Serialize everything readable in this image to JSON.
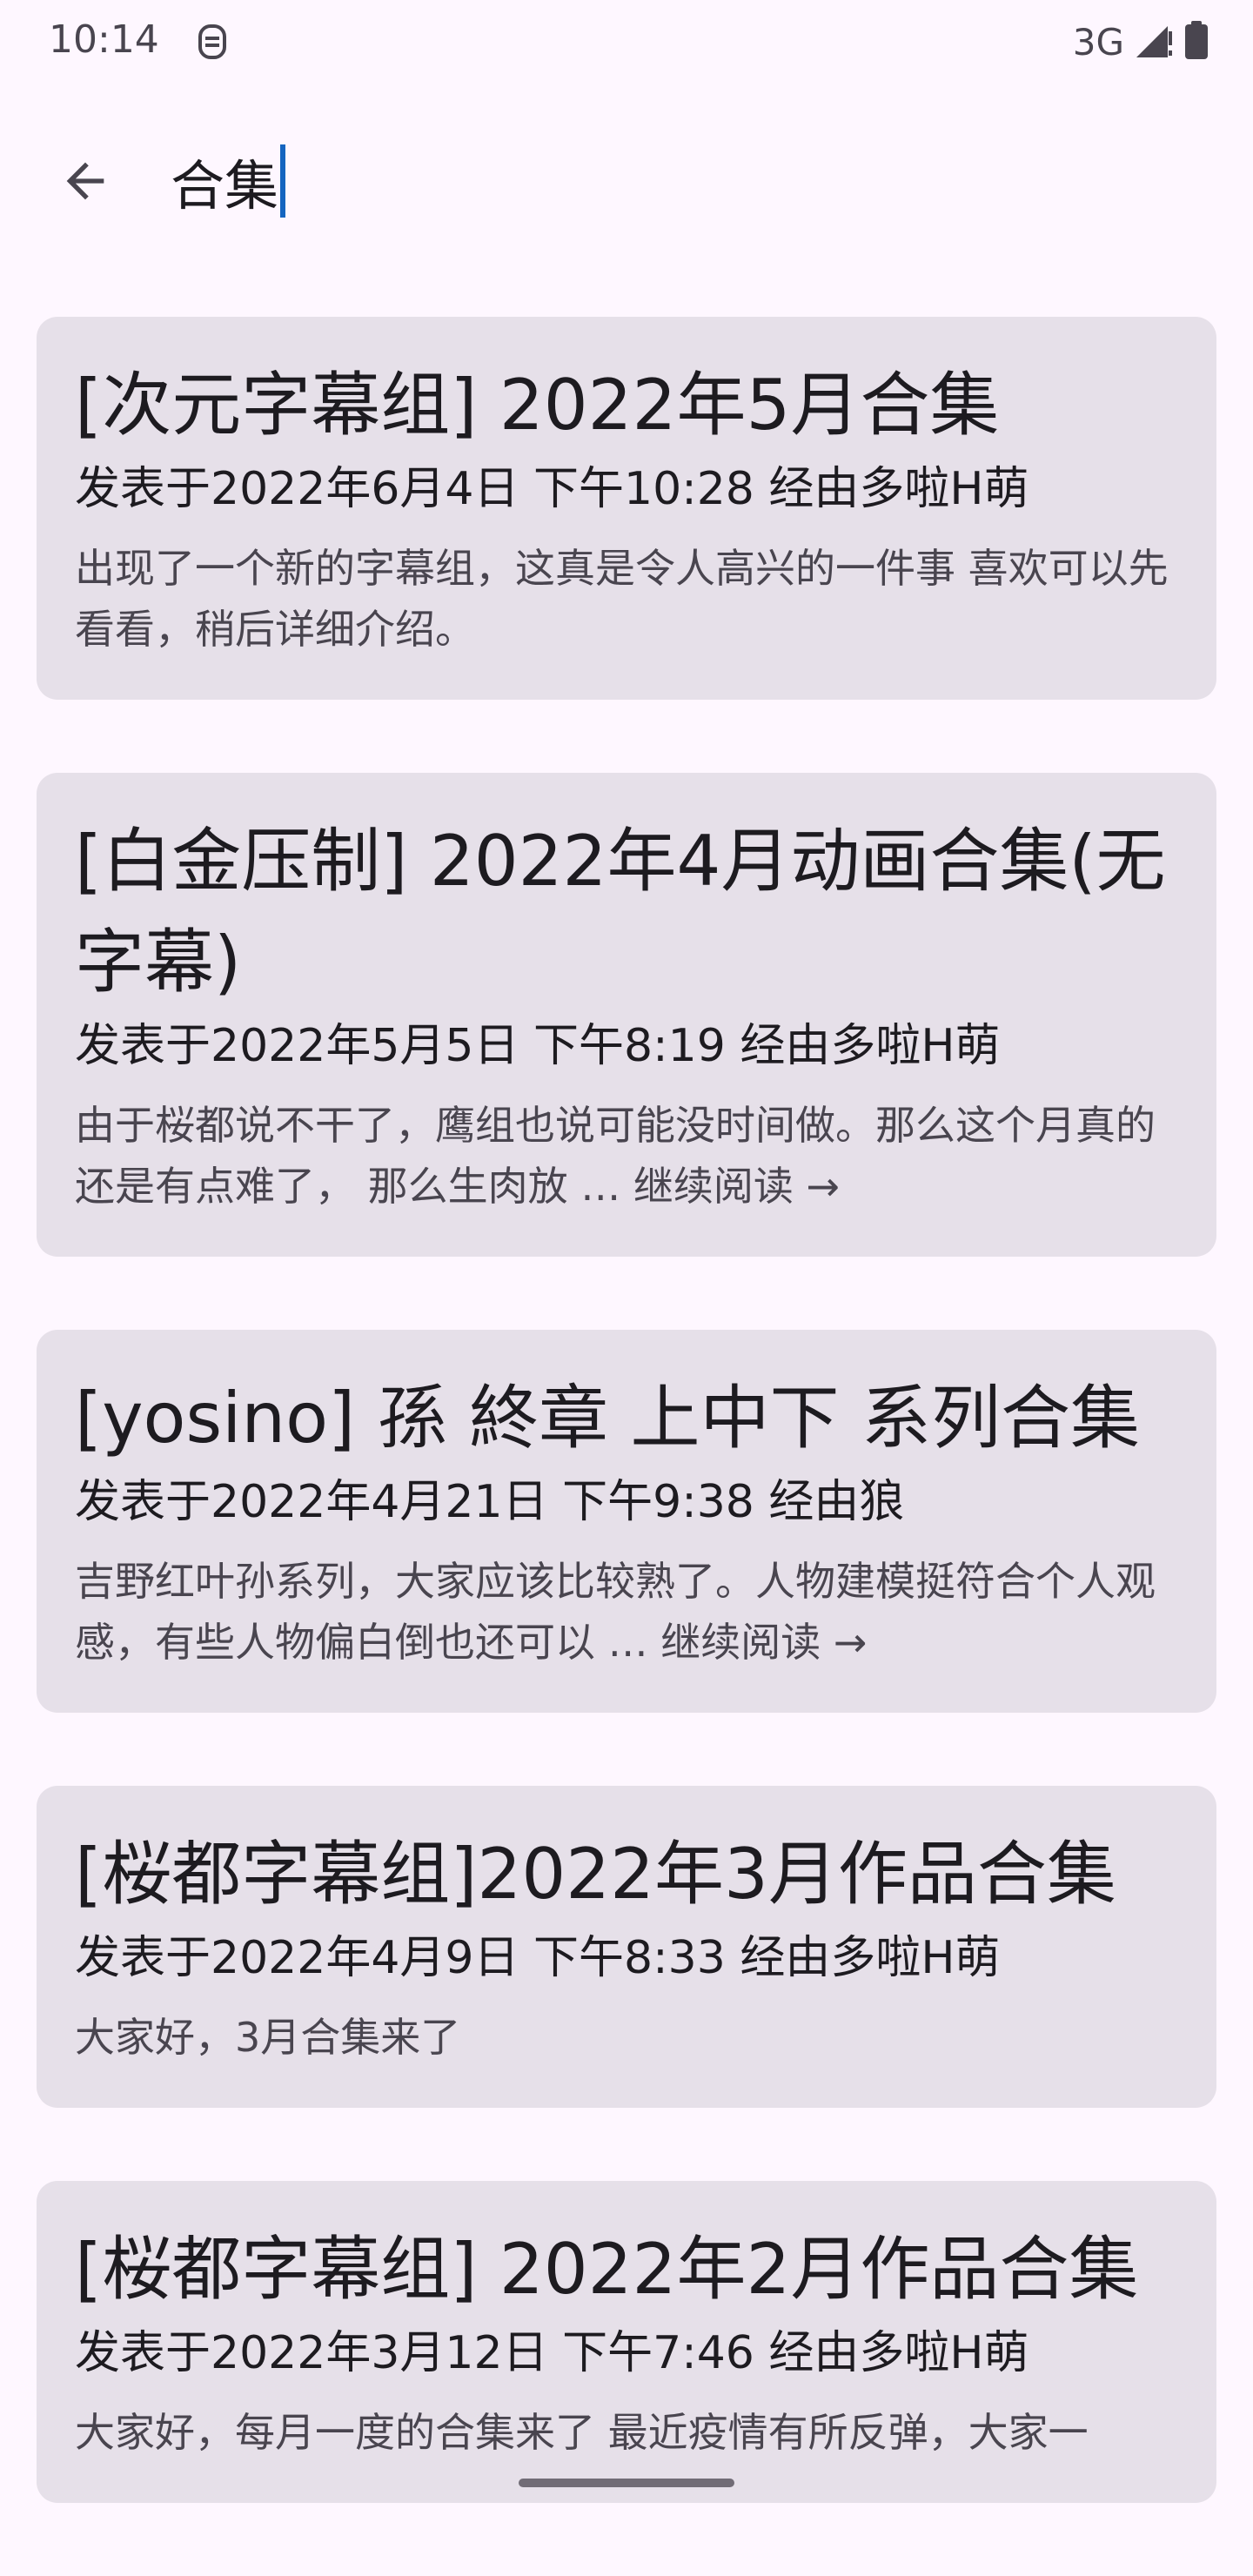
{
  "status_bar": {
    "time": "10:14",
    "network": "3G",
    "icons": [
      "notification-icon",
      "signal-icon",
      "battery-icon"
    ]
  },
  "search": {
    "query": "合集",
    "back_icon": "arrow-back-icon"
  },
  "results": [
    {
      "title": "[次元字幕组] 2022年5月合集",
      "meta": "发表于2022年6月4日 下午10:28 经由多啦H萌",
      "excerpt": "出现了一个新的字幕组，这真是令人高兴的一件事 喜欢可以先看看，稍后详细介绍。",
      "more": ""
    },
    {
      "title": "[白金压制] 2022年4月动画合集(无字幕)",
      "meta": "发表于2022年5月5日 下午8:19 经由多啦H萌",
      "excerpt": "由于桜都说不干了，鹰组也说可能没时间做。那么这个月真的还是有点难了， 那么生肉放 … ",
      "more": "继续阅读 →"
    },
    {
      "title": "[yosino] 孫 終章 上中下 系列合集",
      "meta": "发表于2022年4月21日 下午9:38 经由狼",
      "excerpt": "吉野红叶孙系列，大家应该比较熟了。人物建模挺符合个人观感，有些人物偏白倒也还可以 … ",
      "more": "继续阅读 →"
    },
    {
      "title": "[桜都字幕组]2022年3月作品合集",
      "meta": "发表于2022年4月9日 下午8:33 经由多啦H萌",
      "excerpt": "大家好，3月合集来了",
      "more": ""
    },
    {
      "title": "[桜都字幕组] 2022年2月作品合集",
      "meta": "发表于2022年3月12日 下午7:46 经由多啦H萌",
      "excerpt": "大家好，每月一度的合集来了 最近疫情有所反弹，大家一",
      "more": ""
    }
  ]
}
